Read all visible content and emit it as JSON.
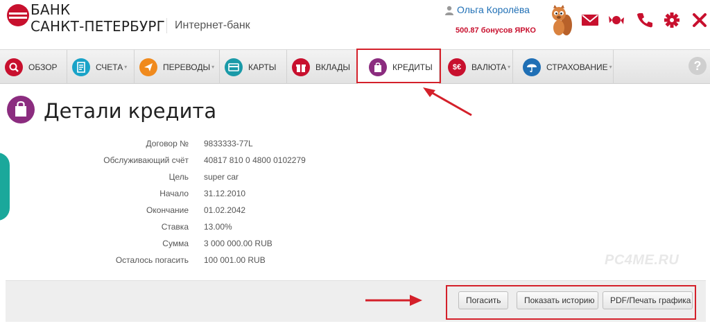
{
  "header": {
    "bank_name_line1": "БАНК",
    "bank_name_line2": "САНКТ-ПЕТЕРБУРГ",
    "internet_bank_label": "Интернет-банк",
    "user_name": "Ольга Королёва",
    "bonus_text": "500.87 бонусов ЯРКО",
    "icons": [
      "mail-icon",
      "candy-icon",
      "phone-icon",
      "gear-icon",
      "close-icon"
    ]
  },
  "nav": {
    "items": [
      {
        "label": "ОБЗОР",
        "icon": "search-icon",
        "color": "#c8102e",
        "dropdown": false
      },
      {
        "label": "СЧЕТА",
        "icon": "document-icon",
        "color": "#19a3c8",
        "dropdown": true
      },
      {
        "label": "ПЕРЕВОДЫ",
        "icon": "send-icon",
        "color": "#f08a1d",
        "dropdown": true
      },
      {
        "label": "КАРТЫ",
        "icon": "card-icon",
        "color": "#1a9aa8",
        "dropdown": false
      },
      {
        "label": "ВКЛАДЫ",
        "icon": "gift-icon",
        "color": "#c8102e",
        "dropdown": false
      },
      {
        "label": "КРЕДИТЫ",
        "icon": "bag-icon",
        "color": "#8b2c7f",
        "dropdown": false
      },
      {
        "label": "ВАЛЮТА",
        "icon": "currency-icon",
        "color": "#c8102e",
        "dropdown": true
      },
      {
        "label": "СТРАХОВАНИЕ",
        "icon": "umbrella-icon",
        "color": "#1f6fb5",
        "dropdown": true
      }
    ],
    "help_label": "?"
  },
  "page": {
    "title": "Детали кредита"
  },
  "details": [
    {
      "label": "Договор №",
      "value": "9833333-77L"
    },
    {
      "label": "Обслуживающий счёт",
      "value": "40817 810 0 4800 0102279"
    },
    {
      "label": "Цель",
      "value": "super car"
    },
    {
      "label": "Начало",
      "value": "31.12.2010"
    },
    {
      "label": "Окончание",
      "value": "01.02.2042"
    },
    {
      "label": "Ставка",
      "value": "13.00%"
    },
    {
      "label": "Сумма",
      "value": "3 000 000.00 RUB"
    },
    {
      "label": "Осталось погасить",
      "value": "100 001.00 RUB"
    }
  ],
  "actions": {
    "pay": "Погасить",
    "history": "Показать историю",
    "pdf": "PDF/Печать графика"
  },
  "watermark": "PC4ME.RU",
  "colors": {
    "brand_red": "#c8102e",
    "link_blue": "#1f6fb5",
    "credit_purple": "#8b2c7f",
    "annotation_red": "#d4202a"
  }
}
